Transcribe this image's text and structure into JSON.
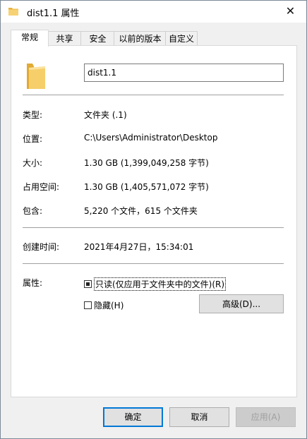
{
  "window": {
    "title": "dist1.1 属性",
    "close_icon": "close-icon"
  },
  "tabs": [
    {
      "label": "常规",
      "active": true
    },
    {
      "label": "共享",
      "active": false
    },
    {
      "label": "安全",
      "active": false
    },
    {
      "label": "以前的版本",
      "active": false
    },
    {
      "label": "自定义",
      "active": false
    }
  ],
  "general": {
    "name_value": "dist1.1",
    "type_label": "类型:",
    "type_value": "文件夹 (.1)",
    "location_label": "位置:",
    "location_value": "C:\\Users\\Administrator\\Desktop",
    "size_label": "大小:",
    "size_value": "1.30 GB (1,399,049,258 字节)",
    "size_on_disk_label": "占用空间:",
    "size_on_disk_value": "1.30 GB (1,405,571,072 字节)",
    "contains_label": "包含:",
    "contains_value": "5,220 个文件，615 个文件夹",
    "created_label": "创建时间:",
    "created_value": "2021年4月27日，15:34:01",
    "attributes_label": "属性:",
    "readonly_label": "只读(仅应用于文件夹中的文件)(R)",
    "hidden_label": "隐藏(H)",
    "advanced_label": "高级(D)..."
  },
  "buttons": {
    "ok": "确定",
    "cancel": "取消",
    "apply": "应用(A)"
  },
  "colors": {
    "folder": "#f4c75a",
    "default_button_border": "#0078d7"
  }
}
